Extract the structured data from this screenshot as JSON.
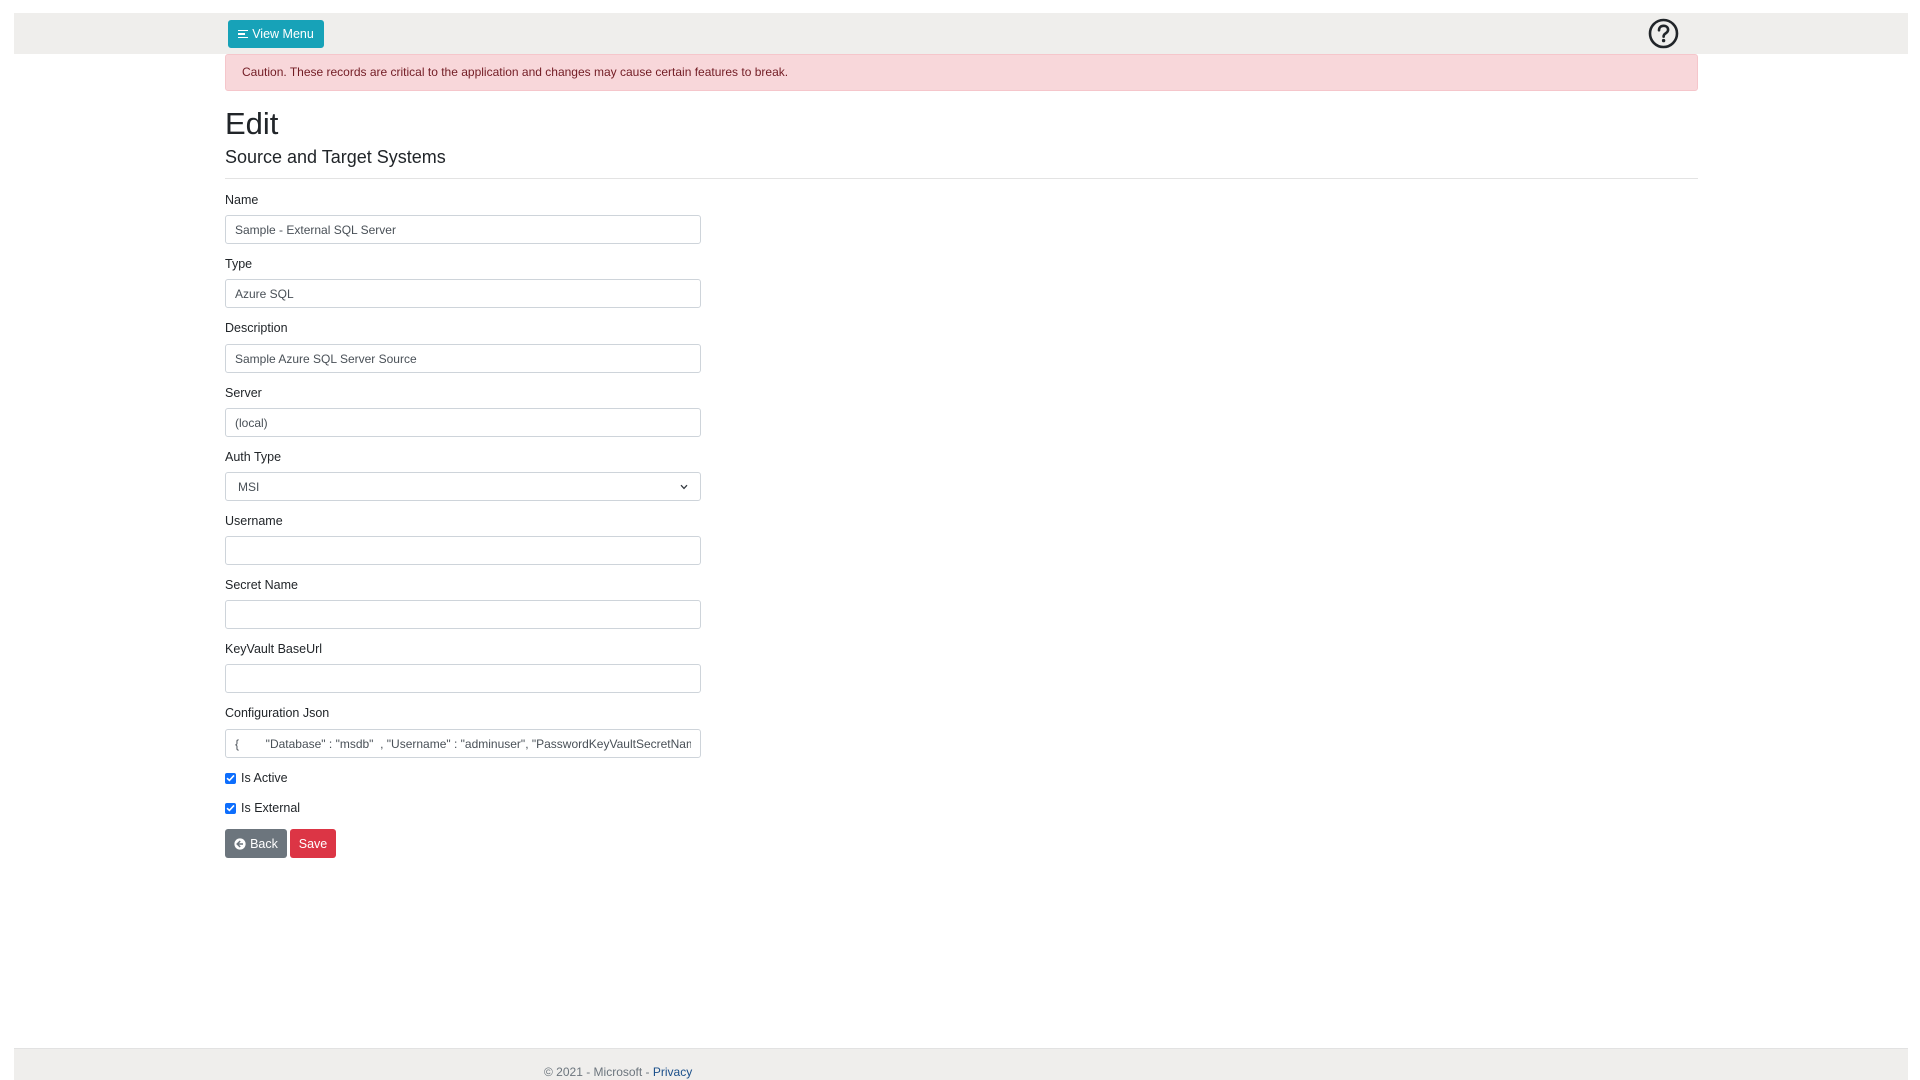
{
  "header": {
    "view_menu_label": "View Menu",
    "menu_icon": "menu-icon",
    "help_icon": "help-circle-icon"
  },
  "alert": {
    "text": "Caution. These records are critical to the application and changes may cause certain features to break."
  },
  "page": {
    "title": "Edit",
    "subtitle": "Source and Target Systems"
  },
  "form": {
    "name": {
      "label": "Name",
      "value": "Sample - External SQL Server"
    },
    "type": {
      "label": "Type",
      "value": "Azure SQL"
    },
    "description": {
      "label": "Description",
      "value": "Sample Azure SQL Server Source"
    },
    "server": {
      "label": "Server",
      "value": "(local)"
    },
    "auth_type": {
      "label": "Auth Type",
      "value": "MSI"
    },
    "username": {
      "label": "Username",
      "value": ""
    },
    "secret_name": {
      "label": "Secret Name",
      "value": ""
    },
    "keyvault_baseurl": {
      "label": "KeyVault BaseUrl",
      "value": ""
    },
    "configuration_json": {
      "label": "Configuration Json",
      "value": "{        \"Database\" : \"msdb\"  , \"Username\" : \"adminuser\", \"PasswordKeyVaultSecretName\""
    },
    "is_active": {
      "label": "Is Active",
      "checked": true
    },
    "is_external": {
      "label": "Is External",
      "checked": true
    }
  },
  "actions": {
    "back_label": "Back",
    "save_label": "Save"
  },
  "footer": {
    "copyright": "© 2021 - Microsoft - ",
    "privacy_label": "Privacy"
  },
  "colors": {
    "accent": "#17a2b8",
    "danger": "#dc3545",
    "secondary": "#6c757d",
    "checkbox": "#0d6efd",
    "alert_bg": "#f8d7da",
    "alert_text": "#721c24"
  }
}
